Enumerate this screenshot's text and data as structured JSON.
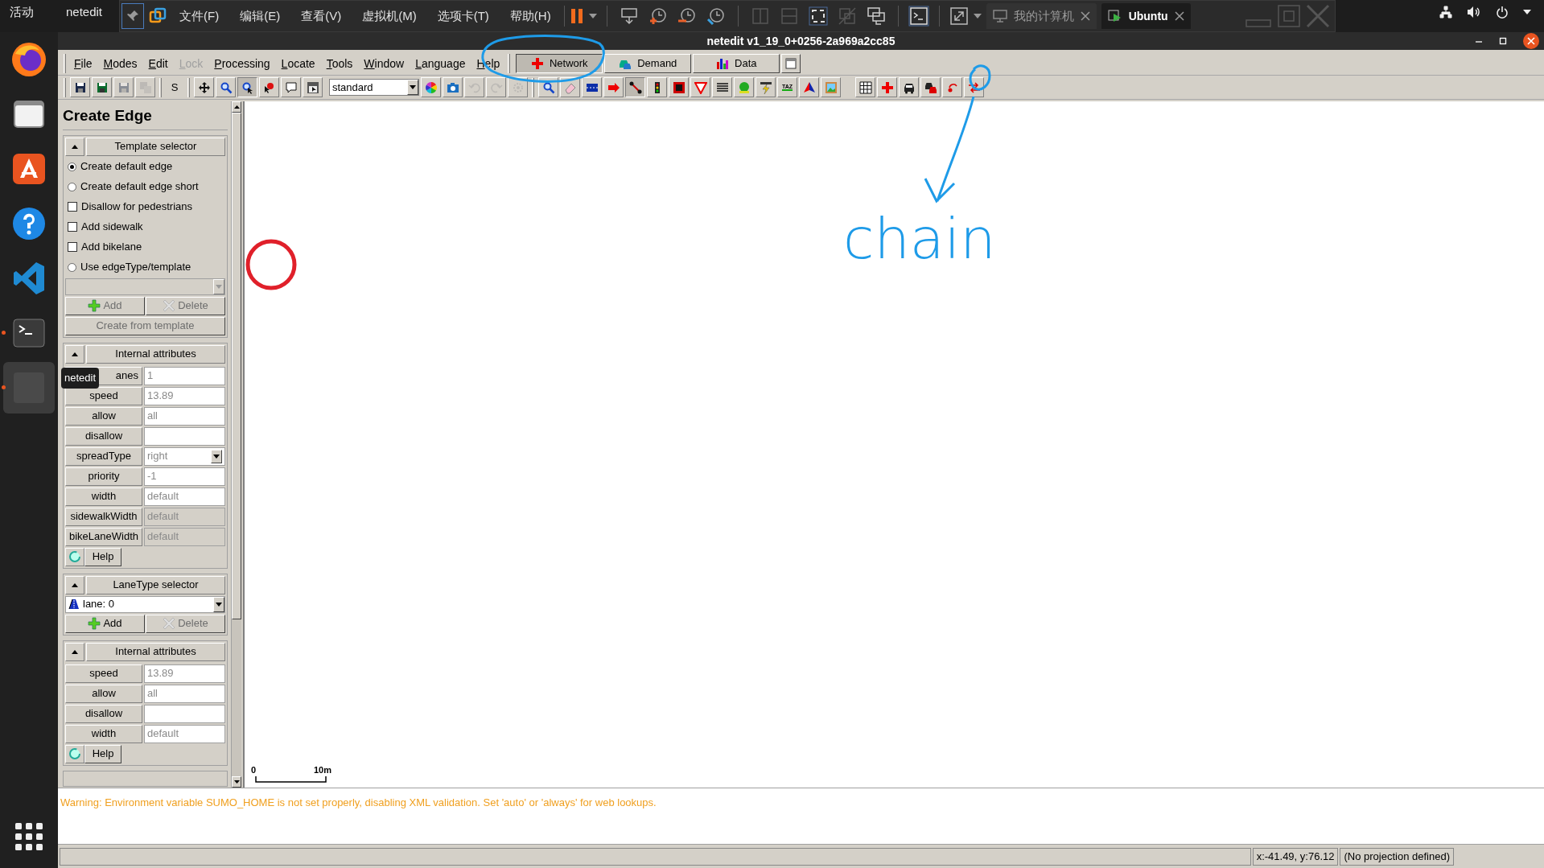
{
  "system_bar": {
    "activities": "活动",
    "app_name": "netedit"
  },
  "vm_toolbar": {
    "menus": [
      "文件(F)",
      "编辑(E)",
      "查看(V)",
      "虚拟机(M)",
      "选项卡(T)",
      "帮助(H)"
    ],
    "tabs": [
      {
        "label": "我的计算机",
        "selected": false
      },
      {
        "label": "Ubuntu",
        "selected": true
      }
    ]
  },
  "dock": {
    "items": [
      {
        "kind": "browser",
        "running": false,
        "selected": false
      },
      {
        "kind": "files",
        "running": false,
        "selected": false
      },
      {
        "kind": "store",
        "running": false,
        "selected": false
      },
      {
        "kind": "help",
        "running": false,
        "selected": false
      },
      {
        "kind": "editor",
        "running": false,
        "selected": false
      },
      {
        "kind": "terminal",
        "running": true,
        "selected": false
      },
      {
        "kind": "blank",
        "running": true,
        "selected": true
      }
    ]
  },
  "window": {
    "title": "netedit v1_19_0+0256-2a969a2cc85"
  },
  "menu_bar": [
    {
      "label": "File",
      "disabled": false
    },
    {
      "label": "Modes",
      "disabled": false
    },
    {
      "label": "Edit",
      "disabled": false
    },
    {
      "label": "Lock",
      "disabled": true
    },
    {
      "label": "Processing",
      "disabled": false
    },
    {
      "label": "Locate",
      "disabled": false
    },
    {
      "label": "Tools",
      "disabled": false
    },
    {
      "label": "Window",
      "disabled": false
    },
    {
      "label": "Language",
      "disabled": false
    },
    {
      "label": "Help",
      "disabled": false
    }
  ],
  "supermodes": [
    {
      "label": "Network",
      "kind": "network",
      "selected": true
    },
    {
      "label": "Demand",
      "kind": "demand",
      "selected": false
    },
    {
      "label": "Data",
      "kind": "data",
      "selected": false
    }
  ],
  "toolbar": {
    "file": [
      {
        "kind": "floppy",
        "disabled": false
      },
      {
        "kind": "floppy-green",
        "disabled": false
      },
      {
        "kind": "floppy",
        "disabled": true
      },
      {
        "kind": "floppies",
        "disabled": true
      }
    ],
    "s_label": "S",
    "modes": [
      {
        "kind": "move-cross",
        "selected": false
      },
      {
        "kind": "magnifier",
        "selected": false
      },
      {
        "kind": "magnifier-cursor",
        "selected": true
      },
      {
        "kind": "pointer-question",
        "selected": false
      },
      {
        "kind": "speech-bubble",
        "selected": false
      },
      {
        "kind": "menu-card",
        "selected": false
      }
    ],
    "scheme": "standard",
    "view": [
      {
        "kind": "color-wheel",
        "disabled": false
      },
      {
        "kind": "camera",
        "disabled": false
      },
      {
        "kind": "undo-arrow",
        "disabled": true
      },
      {
        "kind": "redo-arrow",
        "disabled": true
      },
      {
        "kind": "gear",
        "disabled": true
      }
    ],
    "network_modes": [
      {
        "kind": "magnifier",
        "selected": false
      },
      {
        "kind": "eraser",
        "selected": false
      },
      {
        "kind": "lanes",
        "selected": false
      },
      {
        "kind": "arrow-right",
        "selected": false
      },
      {
        "kind": "connection",
        "selected": true
      },
      {
        "kind": "traffic-light",
        "selected": false
      },
      {
        "kind": "crossing",
        "selected": false
      },
      {
        "kind": "triangle",
        "selected": false
      },
      {
        "kind": "lines",
        "selected": false
      },
      {
        "kind": "green-blob",
        "selected": false
      },
      {
        "kind": "lightning",
        "selected": false
      },
      {
        "kind": "taz",
        "label": "TAZ",
        "selected": false
      },
      {
        "kind": "pyramid",
        "selected": false
      },
      {
        "kind": "picture-frame",
        "selected": false
      }
    ],
    "extra": [
      {
        "kind": "grid"
      },
      {
        "kind": "red-cross"
      },
      {
        "kind": "car"
      },
      {
        "kind": "cars"
      },
      {
        "kind": "dot-arrow"
      },
      {
        "kind": "swap-arrows"
      }
    ]
  },
  "panel": {
    "title": "Create Edge",
    "template_selector": {
      "title": "Template selector",
      "options": [
        {
          "kind": "radio",
          "label": "Create default edge",
          "checked": true
        },
        {
          "kind": "radio",
          "label": "Create default edge short",
          "checked": false
        },
        {
          "kind": "checkbox",
          "label": "Disallow for pedestrians",
          "checked": false
        },
        {
          "kind": "checkbox",
          "label": "Add sidewalk",
          "checked": false
        },
        {
          "kind": "checkbox",
          "label": "Add bikelane",
          "checked": false
        },
        {
          "kind": "radio",
          "label": "Use edgeType/template",
          "checked": false
        }
      ],
      "buttons": [
        {
          "label": "Add",
          "kind": "add",
          "disabled": true
        },
        {
          "label": "Delete",
          "kind": "delete",
          "disabled": true
        }
      ],
      "create_button": {
        "label": "Create from template",
        "disabled": true
      }
    },
    "edge_attributes": {
      "title": "Internal attributes",
      "attributes": [
        {
          "label": "anes",
          "value": "1",
          "kind": "text",
          "disabled": false
        },
        {
          "label": "speed",
          "value": "13.89",
          "kind": "text",
          "disabled": false
        },
        {
          "label": "allow",
          "value": "all",
          "kind": "text",
          "disabled": false
        },
        {
          "label": "disallow",
          "kind": "text",
          "disabled": false
        },
        {
          "label": "spreadType",
          "value": "right",
          "kind": "select",
          "disabled": false
        },
        {
          "label": "priority",
          "value": "-1",
          "kind": "text",
          "disabled": false
        },
        {
          "label": "width",
          "value": "default",
          "kind": "text",
          "disabled": false
        },
        {
          "label": "sidewalkWidth",
          "value": "default",
          "kind": "text",
          "disabled": true
        },
        {
          "label": "bikeLaneWidth",
          "value": "default",
          "kind": "text",
          "disabled": true
        }
      ],
      "help": "Help"
    },
    "lanetype_selector": {
      "title": "LaneType selector",
      "value": "lane: 0",
      "buttons": [
        {
          "label": "Add",
          "kind": "add",
          "disabled": false
        },
        {
          "label": "Delete",
          "kind": "delete",
          "disabled": true
        }
      ]
    },
    "lane_attributes": {
      "title": "Internal attributes",
      "attributes": [
        {
          "label": "speed",
          "value": "13.89",
          "kind": "text",
          "disabled": false
        },
        {
          "label": "allow",
          "value": "all",
          "kind": "text",
          "disabled": false
        },
        {
          "label": "disallow",
          "kind": "text",
          "disabled": false
        },
        {
          "label": "width",
          "value": "default",
          "kind": "text",
          "disabled": false
        }
      ],
      "help": "Help"
    },
    "tooltip": "netedit"
  },
  "canvas": {
    "scale": {
      "start": "0",
      "end": "10m"
    },
    "note": "chain"
  },
  "message": "Warning: Environment variable SUMO_HOME is not set properly, disabling XML validation. Set 'auto' or 'always' for web lookups.",
  "status_bar": {
    "coordinates": "x:-41.49, y:76.12",
    "projection": "(No projection defined)"
  }
}
